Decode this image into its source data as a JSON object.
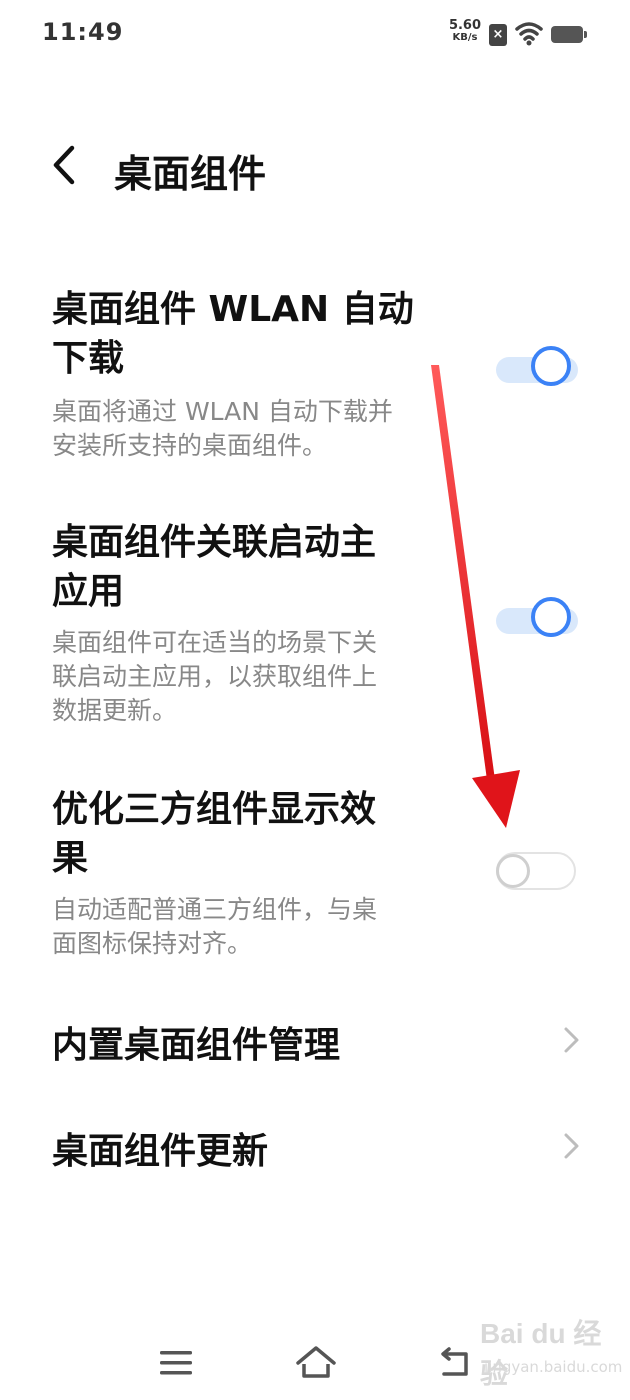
{
  "status_bar": {
    "time": "11:49",
    "net_speed_value": "5.60",
    "net_speed_unit": "KB/s",
    "icons": [
      "sim-blocked-icon",
      "wifi-icon",
      "battery-icon"
    ]
  },
  "header": {
    "back_icon": "chevron-left-icon",
    "title": "桌面组件"
  },
  "settings": [
    {
      "title_lines": [
        "桌面组件 WLAN 自动",
        "下载"
      ],
      "desc_lines": [
        "桌面将通过 WLAN 自动下载并",
        "安装所支持的桌面组件。"
      ],
      "toggle_on": true
    },
    {
      "title_lines": [
        "桌面组件关联启动主",
        "应用"
      ],
      "desc_lines": [
        "桌面组件可在适当的场景下关",
        "联启动主应用，以获取组件上",
        "数据更新。"
      ],
      "toggle_on": true
    },
    {
      "title_lines": [
        "优化三方组件显示效",
        "果"
      ],
      "desc_lines": [
        "自动适配普通三方组件，与桌",
        "面图标保持对齐。"
      ],
      "toggle_on": false
    }
  ],
  "nav_items": [
    {
      "label": "内置桌面组件管理",
      "icon": "chevron-right-icon"
    },
    {
      "label": "桌面组件更新",
      "icon": "chevron-right-icon"
    }
  ],
  "bottom_nav": {
    "icons": [
      "menu-icon",
      "home-icon",
      "back-icon"
    ]
  },
  "watermark": {
    "logo": "Bai du 经验",
    "url": "jingyan.baidu.com"
  },
  "colors": {
    "accent": "#3b82f6",
    "toggle_on_track": "#d9e8fb",
    "annotation_arrow": "#e8141a",
    "secondary_text": "#888888"
  }
}
